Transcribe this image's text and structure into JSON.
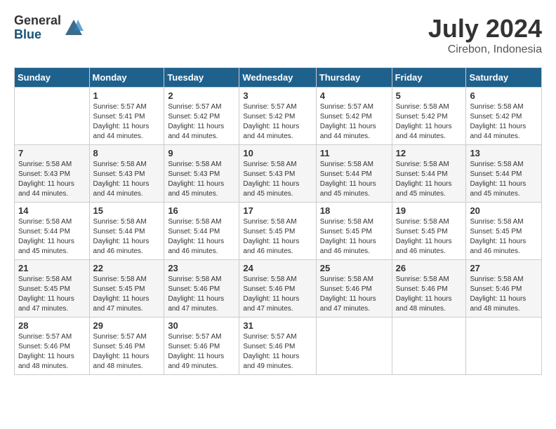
{
  "header": {
    "logo_general": "General",
    "logo_blue": "Blue",
    "month_year": "July 2024",
    "location": "Cirebon, Indonesia"
  },
  "days_of_week": [
    "Sunday",
    "Monday",
    "Tuesday",
    "Wednesday",
    "Thursday",
    "Friday",
    "Saturday"
  ],
  "weeks": [
    [
      {
        "day": "",
        "detail": ""
      },
      {
        "day": "1",
        "detail": "Sunrise: 5:57 AM\nSunset: 5:41 PM\nDaylight: 11 hours\nand 44 minutes."
      },
      {
        "day": "2",
        "detail": "Sunrise: 5:57 AM\nSunset: 5:42 PM\nDaylight: 11 hours\nand 44 minutes."
      },
      {
        "day": "3",
        "detail": "Sunrise: 5:57 AM\nSunset: 5:42 PM\nDaylight: 11 hours\nand 44 minutes."
      },
      {
        "day": "4",
        "detail": "Sunrise: 5:57 AM\nSunset: 5:42 PM\nDaylight: 11 hours\nand 44 minutes."
      },
      {
        "day": "5",
        "detail": "Sunrise: 5:58 AM\nSunset: 5:42 PM\nDaylight: 11 hours\nand 44 minutes."
      },
      {
        "day": "6",
        "detail": "Sunrise: 5:58 AM\nSunset: 5:42 PM\nDaylight: 11 hours\nand 44 minutes."
      }
    ],
    [
      {
        "day": "7",
        "detail": "Sunrise: 5:58 AM\nSunset: 5:43 PM\nDaylight: 11 hours\nand 44 minutes."
      },
      {
        "day": "8",
        "detail": "Sunrise: 5:58 AM\nSunset: 5:43 PM\nDaylight: 11 hours\nand 44 minutes."
      },
      {
        "day": "9",
        "detail": "Sunrise: 5:58 AM\nSunset: 5:43 PM\nDaylight: 11 hours\nand 45 minutes."
      },
      {
        "day": "10",
        "detail": "Sunrise: 5:58 AM\nSunset: 5:43 PM\nDaylight: 11 hours\nand 45 minutes."
      },
      {
        "day": "11",
        "detail": "Sunrise: 5:58 AM\nSunset: 5:44 PM\nDaylight: 11 hours\nand 45 minutes."
      },
      {
        "day": "12",
        "detail": "Sunrise: 5:58 AM\nSunset: 5:44 PM\nDaylight: 11 hours\nand 45 minutes."
      },
      {
        "day": "13",
        "detail": "Sunrise: 5:58 AM\nSunset: 5:44 PM\nDaylight: 11 hours\nand 45 minutes."
      }
    ],
    [
      {
        "day": "14",
        "detail": "Sunrise: 5:58 AM\nSunset: 5:44 PM\nDaylight: 11 hours\nand 45 minutes."
      },
      {
        "day": "15",
        "detail": "Sunrise: 5:58 AM\nSunset: 5:44 PM\nDaylight: 11 hours\nand 46 minutes."
      },
      {
        "day": "16",
        "detail": "Sunrise: 5:58 AM\nSunset: 5:44 PM\nDaylight: 11 hours\nand 46 minutes."
      },
      {
        "day": "17",
        "detail": "Sunrise: 5:58 AM\nSunset: 5:45 PM\nDaylight: 11 hours\nand 46 minutes."
      },
      {
        "day": "18",
        "detail": "Sunrise: 5:58 AM\nSunset: 5:45 PM\nDaylight: 11 hours\nand 46 minutes."
      },
      {
        "day": "19",
        "detail": "Sunrise: 5:58 AM\nSunset: 5:45 PM\nDaylight: 11 hours\nand 46 minutes."
      },
      {
        "day": "20",
        "detail": "Sunrise: 5:58 AM\nSunset: 5:45 PM\nDaylight: 11 hours\nand 46 minutes."
      }
    ],
    [
      {
        "day": "21",
        "detail": "Sunrise: 5:58 AM\nSunset: 5:45 PM\nDaylight: 11 hours\nand 47 minutes."
      },
      {
        "day": "22",
        "detail": "Sunrise: 5:58 AM\nSunset: 5:45 PM\nDaylight: 11 hours\nand 47 minutes."
      },
      {
        "day": "23",
        "detail": "Sunrise: 5:58 AM\nSunset: 5:46 PM\nDaylight: 11 hours\nand 47 minutes."
      },
      {
        "day": "24",
        "detail": "Sunrise: 5:58 AM\nSunset: 5:46 PM\nDaylight: 11 hours\nand 47 minutes."
      },
      {
        "day": "25",
        "detail": "Sunrise: 5:58 AM\nSunset: 5:46 PM\nDaylight: 11 hours\nand 47 minutes."
      },
      {
        "day": "26",
        "detail": "Sunrise: 5:58 AM\nSunset: 5:46 PM\nDaylight: 11 hours\nand 48 minutes."
      },
      {
        "day": "27",
        "detail": "Sunrise: 5:58 AM\nSunset: 5:46 PM\nDaylight: 11 hours\nand 48 minutes."
      }
    ],
    [
      {
        "day": "28",
        "detail": "Sunrise: 5:57 AM\nSunset: 5:46 PM\nDaylight: 11 hours\nand 48 minutes."
      },
      {
        "day": "29",
        "detail": "Sunrise: 5:57 AM\nSunset: 5:46 PM\nDaylight: 11 hours\nand 48 minutes."
      },
      {
        "day": "30",
        "detail": "Sunrise: 5:57 AM\nSunset: 5:46 PM\nDaylight: 11 hours\nand 49 minutes."
      },
      {
        "day": "31",
        "detail": "Sunrise: 5:57 AM\nSunset: 5:46 PM\nDaylight: 11 hours\nand 49 minutes."
      },
      {
        "day": "",
        "detail": ""
      },
      {
        "day": "",
        "detail": ""
      },
      {
        "day": "",
        "detail": ""
      }
    ]
  ]
}
